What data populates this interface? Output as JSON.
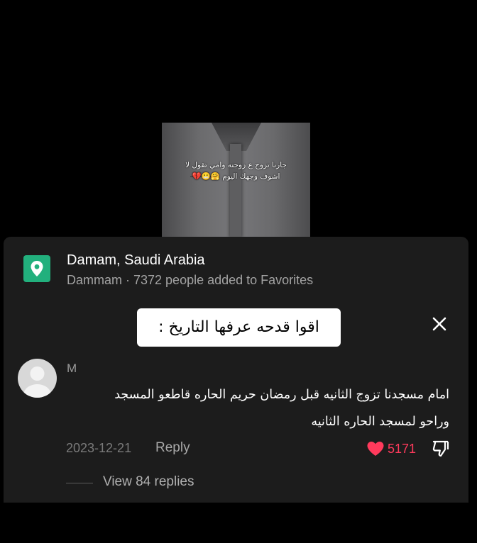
{
  "video": {
    "caption_line1": "جارنا تزوج ع زوجته وامي تقول لا",
    "caption_line2": "اشوف وجهك اليوم 🤗😬💔"
  },
  "location": {
    "title": "Damam, Saudi Arabia",
    "subtitle": "Dammam · 7372 people added to Favorites",
    "icon": "location-pin-icon",
    "icon_color": "#22b07d"
  },
  "overlay": {
    "text": "اقوا قدحه عرفها التاريخ :"
  },
  "comment": {
    "user": "M",
    "text_line1": "امام مسجدنا تزوج الثانيه قبل رمضان حريم الحاره قاطعو المسجد",
    "text_line2": "وراحو لمسجد الحاره الثانيه",
    "date": "2023-12-21",
    "reply_label": "Reply",
    "likes": "5171",
    "like_color": "#ff3a5c",
    "view_replies": "View 84 replies"
  },
  "colors": {
    "background": "#000000",
    "panel": "#1c1c1c",
    "accent_green": "#22b07d"
  }
}
